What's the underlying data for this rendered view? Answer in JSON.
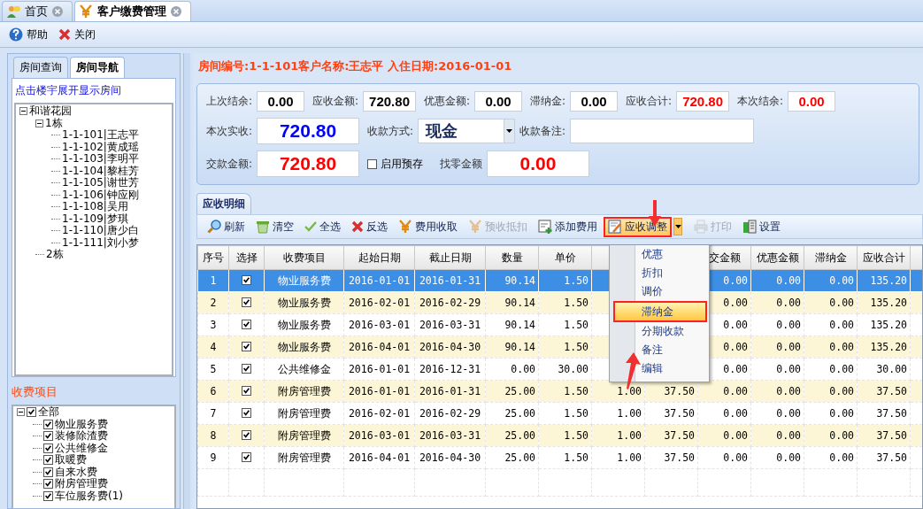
{
  "tabs": [
    {
      "label": "首页",
      "kind": "home",
      "selected": false
    },
    {
      "label": "客户缴费管理",
      "kind": "fee",
      "selected": true
    }
  ],
  "toolbar": [
    {
      "label": "帮助",
      "kind": "help"
    },
    {
      "label": "关闭",
      "kind": "close"
    }
  ],
  "left_panel": {
    "tabs": [
      {
        "label": "房间查询",
        "selected": false
      },
      {
        "label": "房间导航",
        "selected": true
      }
    ],
    "hint": "点击楼宇展开显示房间",
    "tree": [
      {
        "label": "和谐花园",
        "expanded": true,
        "children": [
          {
            "label": "1栋",
            "expanded": true,
            "children": [
              {
                "label": "1-1-101|王志平"
              },
              {
                "label": "1-1-102|黄成瑶"
              },
              {
                "label": "1-1-103|李明平"
              },
              {
                "label": "1-1-104|黎桂芳"
              },
              {
                "label": "1-1-105|谢世芳"
              },
              {
                "label": "1-1-106|钟应刚"
              },
              {
                "label": "1-1-108|吴用"
              },
              {
                "label": "1-1-109|梦琪"
              },
              {
                "label": "1-1-110|唐少白"
              },
              {
                "label": "1-1-111|刘小梦"
              }
            ]
          },
          {
            "label": "2栋"
          }
        ]
      }
    ]
  },
  "fee_items": {
    "title": "收费项目",
    "tree": [
      {
        "label": "全部",
        "checked": true,
        "expanded": true,
        "children": [
          {
            "label": "物业服务费",
            "checked": true
          },
          {
            "label": "装修除渣费",
            "checked": true
          },
          {
            "label": "公共维修金",
            "checked": true
          },
          {
            "label": "取暖费",
            "checked": true
          },
          {
            "label": "自来水费",
            "checked": true
          },
          {
            "label": "附房管理费",
            "checked": true
          },
          {
            "label": "车位服务费(1)",
            "checked": true
          }
        ]
      }
    ]
  },
  "header": "房间编号:1-1-101客户名称:王志平 入住日期:2016-01-01",
  "summary": [
    [
      {
        "label": "上次结余:",
        "kind": "amount",
        "value": "0.00",
        "color": "#000000"
      },
      {
        "label": "应收金额:",
        "kind": "amount",
        "value": "720.80",
        "color": "#000000"
      },
      {
        "label": "优惠金额:",
        "kind": "amount",
        "value": "0.00",
        "color": "#000000"
      },
      {
        "label": "滞纳金:",
        "kind": "amount",
        "value": "0.00",
        "color": "#000000"
      },
      {
        "label": "应收合计:",
        "kind": "amount",
        "value": "720.80",
        "color": "#ff0000"
      },
      {
        "label": "本次结余:",
        "kind": "amount",
        "value": "0.00",
        "color": "#ff0000"
      }
    ],
    [
      {
        "label": "本次实收:",
        "kind": "big",
        "value": "720.80",
        "color": "#0000ff"
      },
      {
        "label": "收款方式:",
        "kind": "select",
        "value": "现金"
      },
      {
        "label": "收款备注:",
        "kind": "text"
      }
    ],
    [
      {
        "label": "交款金额:",
        "kind": "big",
        "value": "720.80",
        "color": "#ff0000"
      },
      {
        "label": "启用预存",
        "kind": "checkbox",
        "checked": false
      },
      {
        "label": "找零金额",
        "kind": "big",
        "value": "0.00",
        "color": "#ff0000"
      }
    ]
  ],
  "detail_tab": "应收明细",
  "detail_toolbar": [
    {
      "label": "刷新",
      "kind": "refresh",
      "disabled": false
    },
    {
      "label": "清空",
      "kind": "trash",
      "disabled": false
    },
    {
      "label": "全选",
      "kind": "check",
      "disabled": false
    },
    {
      "label": "反选",
      "kind": "cross",
      "disabled": false
    },
    {
      "label": "费用收取",
      "kind": "yen",
      "disabled": false
    },
    {
      "label": "预收抵扣",
      "kind": "yen",
      "disabled": true
    },
    {
      "label": "添加费用",
      "kind": "add",
      "disabled": false
    },
    {
      "label": "应收调整",
      "kind": "edit",
      "disabled": false,
      "highlighted": true,
      "dropdown": true
    },
    {
      "label": "打印",
      "kind": "print",
      "disabled": true
    },
    {
      "label": "设置",
      "kind": "settings",
      "disabled": false
    }
  ],
  "table": {
    "columns": [
      "序号",
      "选择",
      "收费项目",
      "起始日期",
      "截止日期",
      "数量",
      "单价",
      null,
      null,
      "交金额",
      "优惠金额",
      "滞纳金",
      "应收合计"
    ],
    "rows": [
      {
        "selected": true,
        "checked": true,
        "cells": [
          "1",
          null,
          "物业服务费",
          "2016-01-01",
          "2016-01-31",
          "90.14",
          "1.50",
          null,
          null,
          "0.00",
          "0.00",
          "0.00",
          "135.20"
        ]
      },
      {
        "selected": false,
        "checked": true,
        "cells": [
          "2",
          null,
          "物业服务费",
          "2016-02-01",
          "2016-02-29",
          "90.14",
          "1.50",
          null,
          null,
          "0.00",
          "0.00",
          "0.00",
          "135.20"
        ]
      },
      {
        "selected": false,
        "checked": true,
        "cells": [
          "3",
          null,
          "物业服务费",
          "2016-03-01",
          "2016-03-31",
          "90.14",
          "1.50",
          null,
          null,
          "0.00",
          "0.00",
          "0.00",
          "135.20"
        ]
      },
      {
        "selected": false,
        "checked": true,
        "cells": [
          "4",
          null,
          "物业服务费",
          "2016-04-01",
          "2016-04-30",
          "90.14",
          "1.50",
          null,
          null,
          "0.00",
          "0.00",
          "0.00",
          "135.20"
        ]
      },
      {
        "selected": false,
        "checked": true,
        "cells": [
          "5",
          null,
          "公共维修金",
          "2016-01-01",
          "2016-12-31",
          "0.00",
          "30.00",
          null,
          null,
          "0.00",
          "0.00",
          "0.00",
          "30.00"
        ]
      },
      {
        "selected": false,
        "checked": true,
        "cells": [
          "6",
          null,
          "附房管理费",
          "2016-01-01",
          "2016-01-31",
          "25.00",
          "1.50",
          "1.00",
          "37.50",
          "0.00",
          "0.00",
          "0.00",
          "37.50"
        ]
      },
      {
        "selected": false,
        "checked": true,
        "cells": [
          "7",
          null,
          "附房管理费",
          "2016-02-01",
          "2016-02-29",
          "25.00",
          "1.50",
          "1.00",
          "37.50",
          "0.00",
          "0.00",
          "0.00",
          "37.50"
        ]
      },
      {
        "selected": false,
        "checked": true,
        "cells": [
          "8",
          null,
          "附房管理费",
          "2016-03-01",
          "2016-03-31",
          "25.00",
          "1.50",
          "1.00",
          "37.50",
          "0.00",
          "0.00",
          "0.00",
          "37.50"
        ]
      },
      {
        "selected": false,
        "checked": true,
        "cells": [
          "9",
          null,
          "附房管理费",
          "2016-04-01",
          "2016-04-30",
          "25.00",
          "1.50",
          "1.00",
          "37.50",
          "0.00",
          "0.00",
          "0.00",
          "37.50"
        ]
      }
    ]
  },
  "menu": [
    {
      "label": "优惠",
      "highlighted": false
    },
    {
      "label": "折扣",
      "highlighted": false
    },
    {
      "label": "调价",
      "highlighted": false
    },
    {
      "label": "滞纳金",
      "highlighted": true
    },
    {
      "label": "分期收款",
      "highlighted": false
    },
    {
      "label": "备注",
      "highlighted": false
    },
    {
      "label": "编辑",
      "highlighted": false
    }
  ]
}
